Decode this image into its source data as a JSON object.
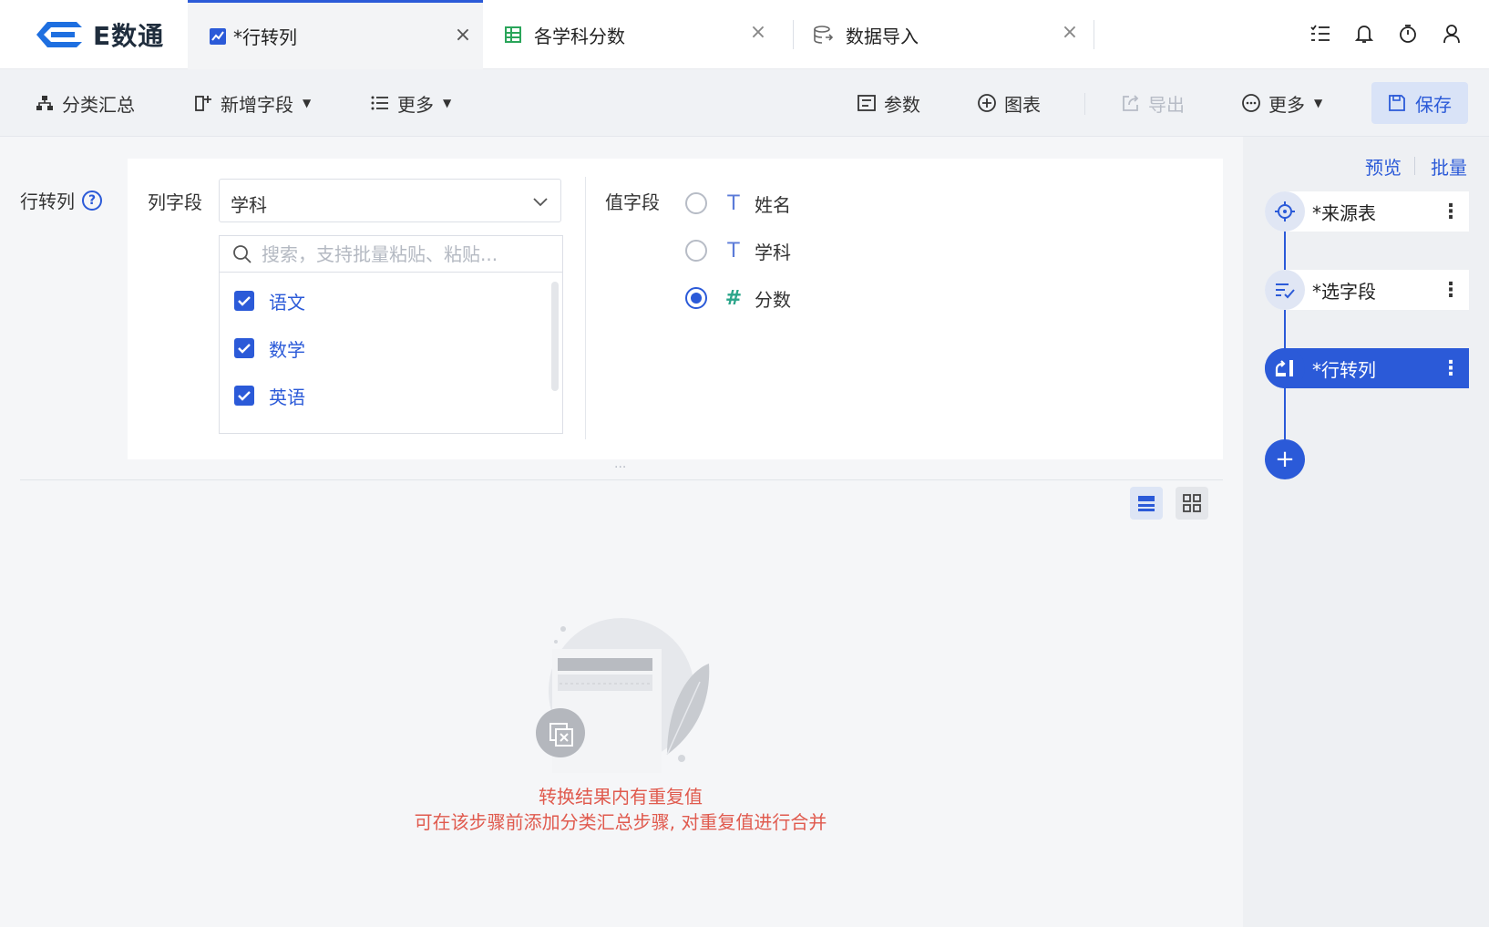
{
  "app": {
    "logo_text": "E数通"
  },
  "tabs": [
    {
      "label": "*行转列",
      "icon": "line-chart-icon",
      "active": true
    },
    {
      "label": "各学科分数",
      "icon": "table-icon",
      "active": false
    },
    {
      "label": "数据导入",
      "icon": "database-icon",
      "active": false
    }
  ],
  "tab_close": "×",
  "top_icons": [
    "task-list-icon",
    "bell-icon",
    "timer-icon",
    "user-icon"
  ],
  "toolbar": {
    "group_summary": "分类汇总",
    "add_field": "新增字段",
    "more_left": "更多",
    "params": "参数",
    "chart": "图表",
    "export": "导出",
    "more_right": "更多",
    "save": "保存"
  },
  "step_config": {
    "title": "行转列",
    "help": "?",
    "column_field_label": "列字段",
    "column_field_value": "学科",
    "search_placeholder": "搜索，支持批量粘贴、粘贴...",
    "options": [
      {
        "label": "语文",
        "checked": true
      },
      {
        "label": "数学",
        "checked": true
      },
      {
        "label": "英语",
        "checked": true
      }
    ],
    "value_field_label": "值字段",
    "value_fields": [
      {
        "label": "姓名",
        "type_glyph": "T",
        "selected": false
      },
      {
        "label": "学科",
        "type_glyph": "T",
        "selected": false
      },
      {
        "label": "分数",
        "type_glyph": "#",
        "selected": true
      }
    ]
  },
  "resizer_dots": "···",
  "empty_state": {
    "line1": "转换结果内有重复值",
    "line2": "可在该步骤前添加分类汇总步骤, 对重复值进行合并"
  },
  "sidebar": {
    "preview": "预览",
    "batch": "批量",
    "steps": [
      {
        "label": "*来源表",
        "icon": "crosshair-icon",
        "active": false
      },
      {
        "label": "*选字段",
        "icon": "select-fields-icon",
        "active": false
      },
      {
        "label": "*行转列",
        "icon": "pivot-icon",
        "active": true
      }
    ],
    "more_glyph": "⋮",
    "add": "+"
  },
  "colors": {
    "accent": "#2b5ad8",
    "error": "#e05a4e"
  }
}
